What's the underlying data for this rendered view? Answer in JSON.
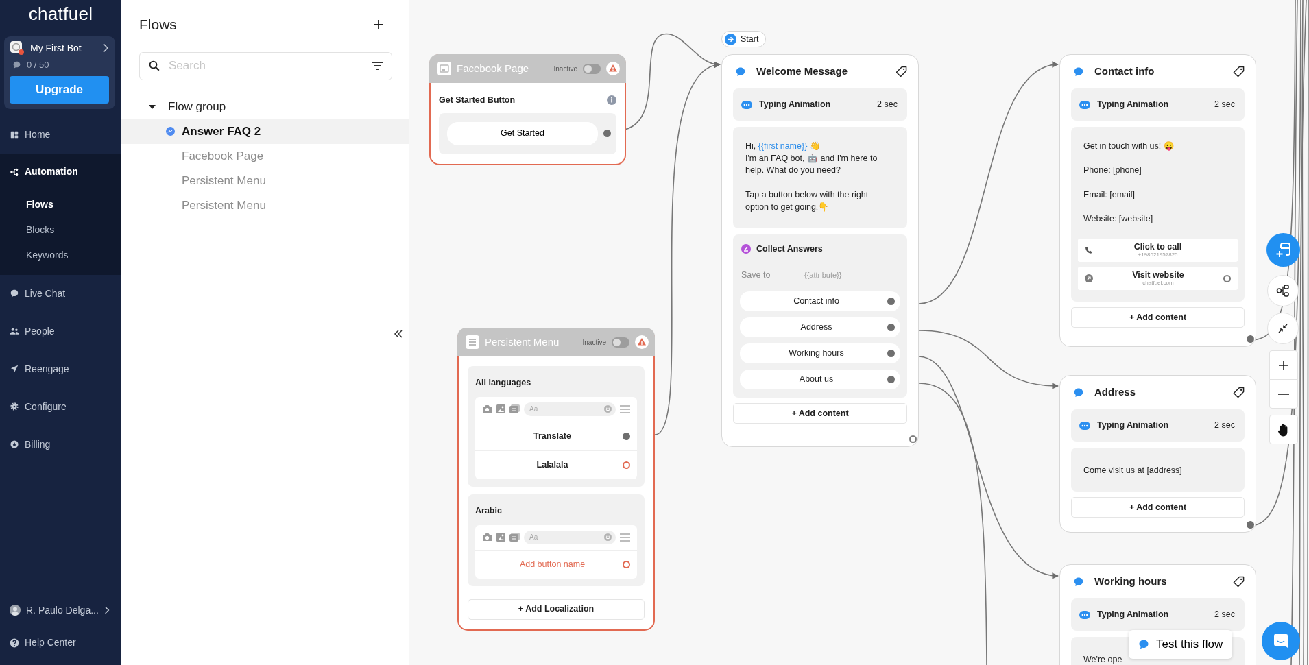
{
  "sidebar": {
    "logo": "chatfuel",
    "bot": {
      "name": "My First Bot",
      "usage": "0 / 50"
    },
    "upgrade": "Upgrade",
    "nav": [
      {
        "label": "Home",
        "selected": false
      },
      {
        "label": "Automation",
        "selected": true,
        "children": [
          {
            "label": "Flows",
            "selected": true
          },
          {
            "label": "Blocks",
            "selected": false
          },
          {
            "label": "Keywords",
            "selected": false
          }
        ]
      },
      {
        "label": "Live Chat",
        "selected": false
      },
      {
        "label": "People",
        "selected": false
      },
      {
        "label": "Reengage",
        "selected": false
      },
      {
        "label": "Configure",
        "selected": false
      },
      {
        "label": "Billing",
        "selected": false
      }
    ],
    "user": "R. Paulo Delga...",
    "help": "Help Center"
  },
  "flows_panel": {
    "title": "Flows",
    "search": {
      "placeholder": "Search"
    },
    "tree": [
      {
        "label": "Flow group",
        "expanded": true,
        "children": [
          {
            "label": "Answer FAQ 2",
            "selected": true
          },
          {
            "label": "Facebook Page",
            "selected": false
          },
          {
            "label": "Persistent Menu",
            "selected": false
          },
          {
            "label": "Persistent Menu",
            "selected": false
          }
        ]
      }
    ]
  },
  "canvas": {
    "entry_points": [
      {
        "kind": "facebook",
        "title": "Facebook Page",
        "status": "Inactive",
        "active": false,
        "warning": true,
        "section": "Get Started Button",
        "buttons": [
          {
            "label": "Get Started",
            "connected": true
          }
        ]
      },
      {
        "kind": "menu",
        "title": "Persistent Menu",
        "status": "Inactive",
        "active": false,
        "warning": true,
        "localizations": [
          {
            "title": "All languages",
            "input_placeholder": "Aa",
            "buttons": [
              {
                "label": "Translate",
                "connected": true,
                "empty": false
              },
              {
                "label": "Lalalala",
                "connected": false,
                "empty": false
              }
            ]
          },
          {
            "title": "Arabic",
            "input_placeholder": "Aa",
            "buttons": [
              {
                "label": "Add button name",
                "connected": false,
                "empty": true
              }
            ]
          }
        ],
        "add": "+ Add Localization"
      }
    ],
    "blocks": [
      {
        "title": "Welcome Message",
        "start": "Start",
        "connected": false,
        "add": "+ Add content",
        "cards": [
          {
            "kind": "typing",
            "label": "Typing Animation",
            "duration": "2 sec"
          },
          {
            "kind": "text",
            "segments": [
              {
                "text": "Hi, ",
                "attribute": false
              },
              {
                "text": "{{first name}}",
                "attribute": true
              },
              {
                "text": " 👋\nI'm an FAQ bot, 🤖 and I'm here to help. What do you need?\n\nTap a button below with the right option to get going.👇",
                "attribute": false
              }
            ]
          },
          {
            "kind": "collect",
            "label": "Collect Answers",
            "save_to": "Save to",
            "save_placeholder": "{{attribute}}",
            "buttons": [
              {
                "label": "Contact info",
                "connected": true
              },
              {
                "label": "Address",
                "connected": true
              },
              {
                "label": "Working hours",
                "connected": true
              },
              {
                "label": "About us",
                "connected": true
              }
            ]
          }
        ]
      },
      {
        "title": "Contact info",
        "connected": true,
        "add": "+ Add content",
        "cards": [
          {
            "kind": "typing",
            "label": "Typing Animation",
            "duration": "2 sec"
          },
          {
            "kind": "text",
            "segments": [
              {
                "text": "Get in touch with us! 😛\n\nPhone: [phone]\n\nEmail: [email]\n\nWebsite: [website]",
                "attribute": false
              }
            ],
            "buttons": [
              {
                "kind": "call",
                "title": "Click to call",
                "subtitle": "+198621957825"
              },
              {
                "kind": "url",
                "title": "Visit website",
                "subtitle": "chatfuel.com",
                "connected": false
              }
            ]
          }
        ]
      },
      {
        "title": "Address",
        "connected": true,
        "add": "+ Add content",
        "cards": [
          {
            "kind": "typing",
            "label": "Typing Animation",
            "duration": "2 sec"
          },
          {
            "kind": "text",
            "segments": [
              {
                "text": "Come visit us at [address]",
                "attribute": false
              }
            ]
          }
        ]
      },
      {
        "title": "Working hours",
        "cards": [
          {
            "kind": "typing",
            "label": "Typing Animation",
            "duration": "2 sec"
          },
          {
            "kind": "text",
            "segments": [
              {
                "text": "We're ope",
                "attribute": false
              }
            ]
          }
        ]
      }
    ],
    "test_button": "Test this flow"
  }
}
